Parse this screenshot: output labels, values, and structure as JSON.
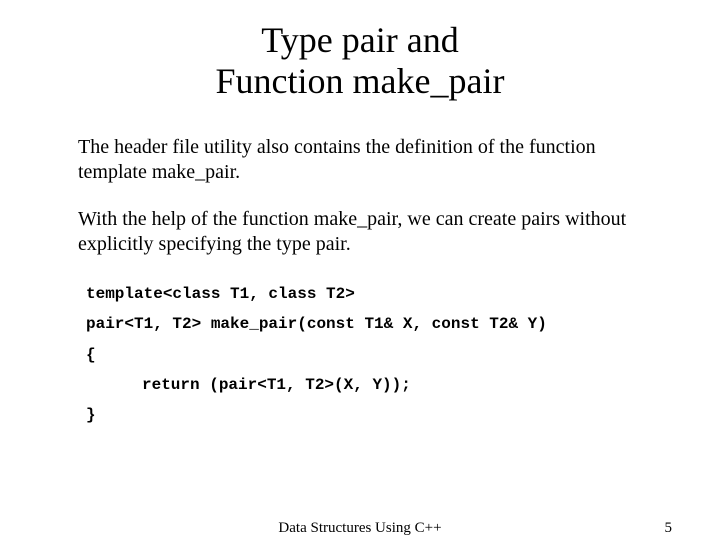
{
  "title_line1": "Type pair and",
  "title_line2": "Function make_pair",
  "paragraph1": "The header file utility also contains the definition of the function template make_pair.",
  "paragraph2": "With the help of the function make_pair,  we can create pairs without explicitly specifying the type pair.",
  "code": {
    "line1": "template<class T1, class T2>",
    "line2": "pair<T1, T2> make_pair(const T1& X, const T2& Y)",
    "line3": "{",
    "line4": "return (pair<T1, T2>(X, Y));",
    "line5": "}"
  },
  "footer": {
    "center": "Data Structures Using C++",
    "page": "5"
  }
}
